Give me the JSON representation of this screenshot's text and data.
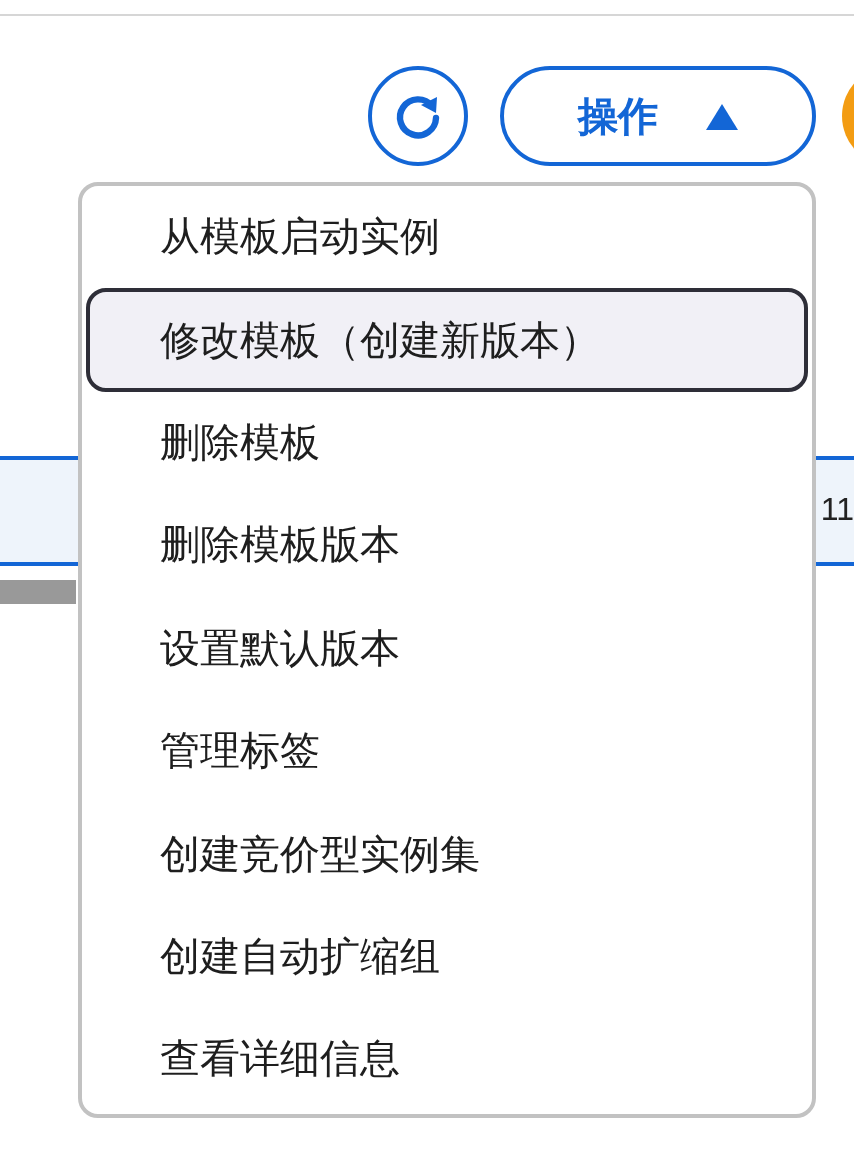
{
  "toolbar": {
    "refresh_button": {
      "kind": "refresh"
    },
    "actions_button": {
      "label": "操作",
      "expanded": true
    }
  },
  "table": {
    "rows": [
      {
        "cell": "11",
        "selected": true
      }
    ]
  },
  "menu": {
    "items": [
      {
        "label": "从模板启动实例",
        "selected": false
      },
      {
        "label": "修改模板（创建新版本）",
        "selected": true
      },
      {
        "label": "删除模板",
        "selected": false
      },
      {
        "label": "删除模板版本",
        "selected": false
      },
      {
        "label": "设置默认版本",
        "selected": false
      },
      {
        "label": "管理标签",
        "selected": false
      },
      {
        "label": "创建竞价型实例集",
        "selected": false
      },
      {
        "label": "创建自动扩缩组",
        "selected": false
      },
      {
        "label": "查看详细信息",
        "selected": false
      }
    ]
  }
}
